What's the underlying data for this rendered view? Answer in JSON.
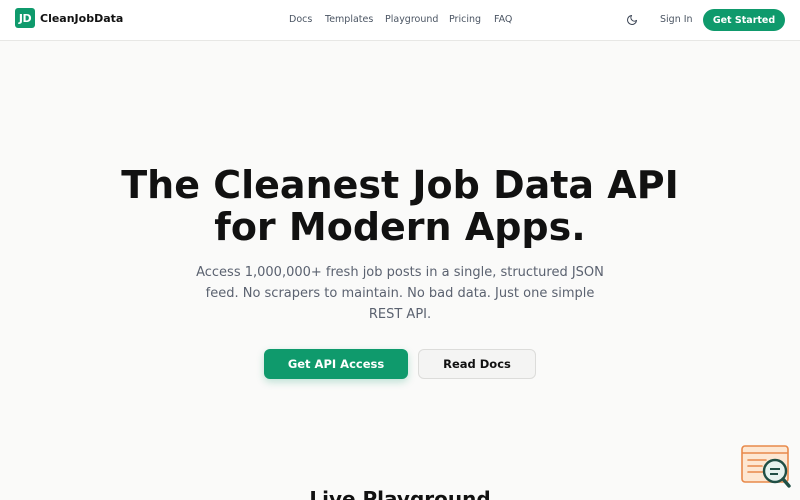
{
  "brand": {
    "logo_text": "JD",
    "name": "CleanJobData",
    "accent": "#0f9a6c"
  },
  "nav": {
    "items": [
      {
        "label": "Docs"
      },
      {
        "label": "Templates"
      },
      {
        "label": "Playground"
      },
      {
        "label": "Pricing"
      },
      {
        "label": "FAQ"
      }
    ],
    "theme_icon": "moon-icon",
    "signin_label": "Sign In",
    "cta_label": "Get Started"
  },
  "hero": {
    "title_line1": "The Cleanest Job Data API",
    "title_line2": "for Modern Apps.",
    "subtitle": "Access 1,000,000+ fresh job posts in a single, structured JSON feed. No scrapers to maintain. No bad data. Just one simple REST API.",
    "primary_cta": "Get API Access",
    "secondary_cta": "Read Docs"
  },
  "playground": {
    "heading": "Live Playground"
  },
  "widget": {
    "icon": "chat-search-icon"
  }
}
